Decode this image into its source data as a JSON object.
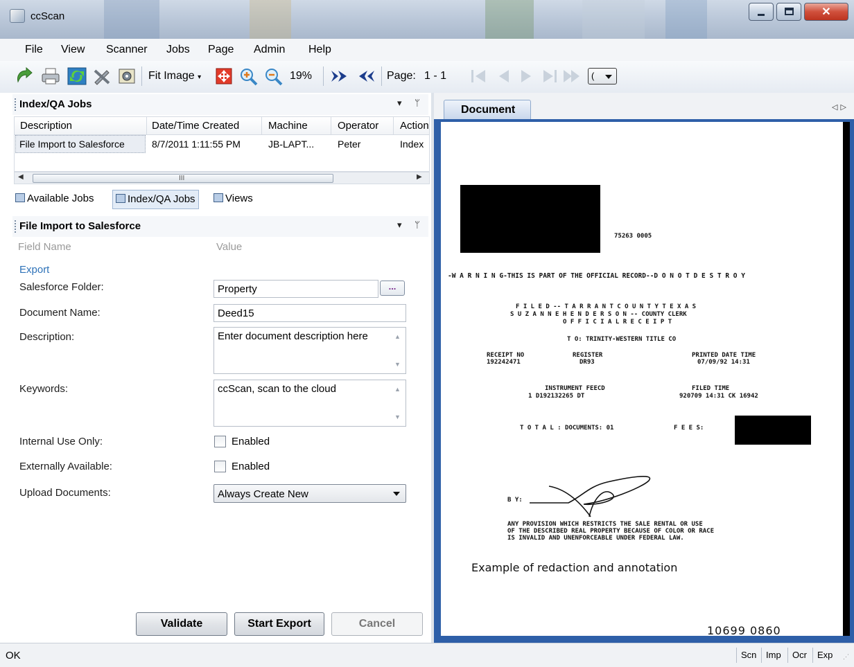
{
  "window": {
    "title": "ccScan"
  },
  "menu": [
    "File",
    "View",
    "Scanner",
    "Jobs",
    "Page",
    "Admin",
    "Help"
  ],
  "toolbar": {
    "fit_image_label": "Fit Image",
    "zoom_level": "19%",
    "page_label": "Page:",
    "page_value": "1 - 1",
    "combo_value": "("
  },
  "jobs_panel": {
    "title": "Index/QA Jobs",
    "columns": [
      "Description",
      "Date/Time Created",
      "Machine",
      "Operator",
      "Action"
    ],
    "rows": [
      [
        "File Import to Salesforce",
        "8/7/2011 1:11:55 PM",
        "JB-LAPT...",
        "Peter",
        "Index"
      ]
    ],
    "scroll_grip": "III"
  },
  "tabs": [
    "Available Jobs",
    "Index/QA Jobs",
    "Views"
  ],
  "form_panel": {
    "title": "File Import to Salesforce",
    "field_name_header": "Field Name",
    "value_header": "Value",
    "group": "Export",
    "fields": {
      "salesforce_folder": {
        "label": "Salesforce Folder:",
        "value": "Property",
        "browse": "..."
      },
      "document_name": {
        "label": "Document Name:",
        "value": "Deed15"
      },
      "description": {
        "label": "Description:",
        "value": "Enter document description here"
      },
      "keywords": {
        "label": "Keywords:",
        "value": "ccScan, scan to the cloud"
      },
      "internal_use": {
        "label": "Internal Use Only:",
        "checkbox_label": "Enabled",
        "checked": false
      },
      "external": {
        "label": "Externally Available:",
        "checkbox_label": "Enabled",
        "checked": false
      },
      "upload": {
        "label": "Upload Documents:",
        "value": "Always Create New"
      }
    },
    "buttons": {
      "validate": "Validate",
      "start_export": "Start Export",
      "cancel": "Cancel"
    }
  },
  "document": {
    "tab_label": "Document",
    "lines": {
      "ref": "75263 0005",
      "warning": "-W A R N I N G-THIS IS PART OF THE OFFICIAL RECORD--D O  N O T  D E S T R O Y",
      "filed": "F I L E D -- T A R R A N T  C O U N T Y  T E X A S",
      "clerk": "S U Z A N N E   H E N D E R S O N -- COUNTY CLERK",
      "receipt_title": "O F F I C I A L  R E C E I P T",
      "to": "T O:   TRINITY-WESTERN TITLE CO",
      "receipt_no_label": "RECEIPT NO",
      "receipt_no": "192242471",
      "register_label": "REGISTER",
      "register": "DR93",
      "printed_label": "PRINTED DATE  TIME",
      "printed": "07/09/92   14:31",
      "instrument_label": "INSTRUMENT FEECD",
      "instrument": "1   D192132265   DT",
      "filed_label": "FILED   TIME",
      "filed_value": "920709  14:31   CK 16942",
      "total": "T O T A L :   DOCUMENTS: 01",
      "fees": "F E E S:",
      "by": "B Y:",
      "provision1": "ANY PROVISION WHICH RESTRICTS THE SALE RENTAL OR USE",
      "provision2": "OF THE DESCRIBED REAL PROPERTY BECAUSE OF COLOR OR RACE",
      "provision3": "IS INVALID AND UNENFORCEABLE UNDER FEDERAL LAW.",
      "annotation": "Example of redaction and annotation",
      "page_number": "10699  0860"
    }
  },
  "status": {
    "text": "OK",
    "cells": [
      "Scn",
      "Imp",
      "Ocr",
      "Exp"
    ]
  }
}
